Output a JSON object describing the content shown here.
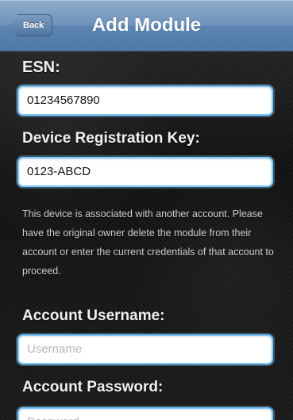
{
  "navbar": {
    "back_label": "Back",
    "title": "Add Module"
  },
  "form": {
    "esn": {
      "label": "ESN:",
      "value": "01234567890"
    },
    "device_registration_key": {
      "label": "Device Registration Key:",
      "value": "0123-ABCD"
    },
    "message": "This device is associated with another account. Please have the original owner delete the module from their account or enter the current credentials of that account to proceed.",
    "account_username": {
      "label": "Account Username:",
      "placeholder": "Username"
    },
    "account_password": {
      "label": "Account Password:",
      "placeholder": "Password"
    }
  },
  "colors": {
    "navbar_blue": "#5b84b1",
    "field_outline": "#7ac8ff",
    "background": "#1a1a1a"
  }
}
